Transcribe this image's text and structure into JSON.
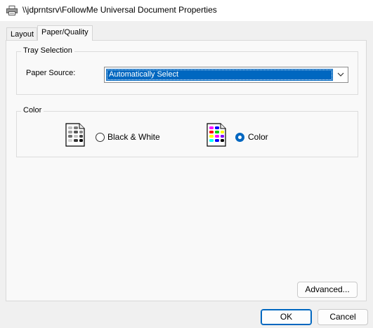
{
  "window": {
    "title": "\\\\jdprntsrv\\FollowMe Universal Document Properties",
    "title_icon": "printer-icon"
  },
  "tabs": [
    {
      "label": "Layout",
      "selected": false
    },
    {
      "label": "Paper/Quality",
      "selected": true
    }
  ],
  "tray_selection": {
    "group_label": "Tray Selection",
    "paper_source_label": "Paper Source:",
    "paper_source_value": "Automatically Select"
  },
  "color": {
    "group_label": "Color",
    "options": [
      {
        "label": "Black & White",
        "icon": "black-white-page-icon",
        "selected": false
      },
      {
        "label": "Color",
        "icon": "color-page-icon",
        "selected": true
      }
    ]
  },
  "buttons": {
    "advanced": "Advanced...",
    "ok": "OK",
    "cancel": "Cancel"
  },
  "colors": {
    "accent": "#0067c0",
    "background": "#f0f0f0",
    "panel": "#f9f9f9"
  }
}
